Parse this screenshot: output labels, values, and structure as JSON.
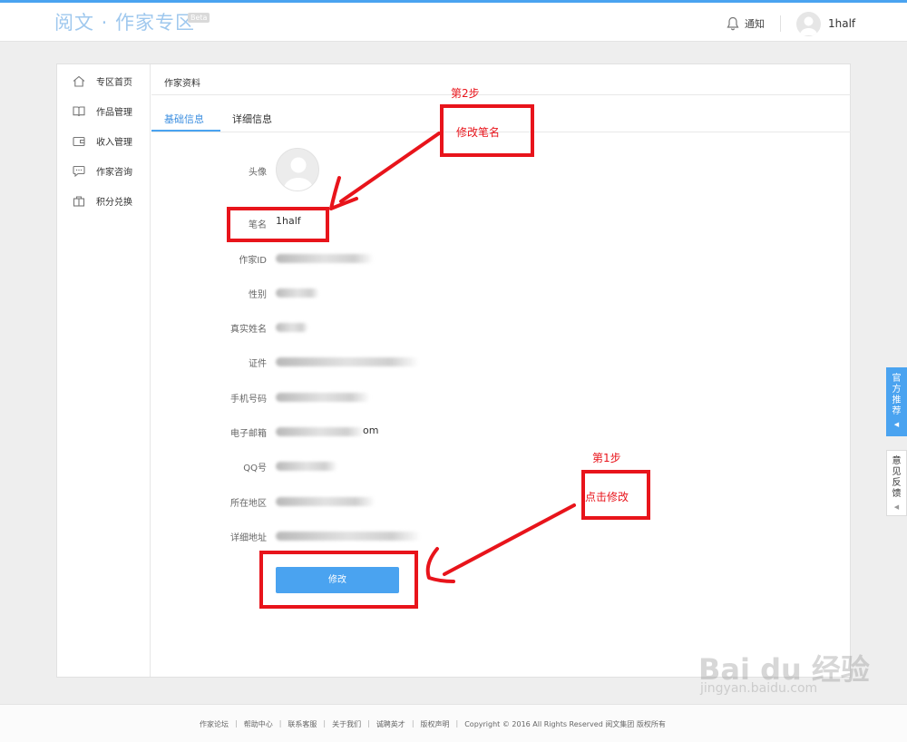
{
  "header": {
    "logo": "阅文 · 作家专区",
    "beta": "Beta",
    "notice": "通知",
    "username": "1half"
  },
  "sidebar": {
    "items": [
      {
        "label": "专区首页",
        "icon": "home-icon"
      },
      {
        "label": "作品管理",
        "icon": "book-icon"
      },
      {
        "label": "收入管理",
        "icon": "wallet-icon"
      },
      {
        "label": "作家咨询",
        "icon": "chat-icon"
      },
      {
        "label": "积分兑换",
        "icon": "gift-icon"
      }
    ]
  },
  "content": {
    "title": "作家资料",
    "tabs": [
      "基础信息",
      "详细信息"
    ],
    "labels": {
      "avatar": "头像",
      "pen_name": "笔名",
      "author_id": "作家ID",
      "gender": "性别",
      "real_name": "真实姓名",
      "id_card": "证件",
      "phone": "手机号码",
      "email": "电子邮箱",
      "qq": "QQ号",
      "region": "所在地区",
      "address": "详细地址"
    },
    "pen_name_value": "1half",
    "email_suffix": "om",
    "modify_button": "修改"
  },
  "annotations": {
    "step2": "第2步",
    "modify_pen_name": "修改笔名",
    "step1": "第1步",
    "click_modify": "点击修改"
  },
  "float": {
    "recommend": [
      "官",
      "方",
      "推",
      "荐"
    ],
    "feedback": [
      "意",
      "见",
      "反",
      "馈"
    ]
  },
  "footer": {
    "links": [
      "作家论坛",
      "帮助中心",
      "联系客服",
      "关于我们",
      "诚聘英才",
      "版权声明"
    ],
    "copyright": "Copyright © 2016 All Rights Reserved 阅文集团 版权所有"
  },
  "watermark": {
    "main": "Bai du 经验",
    "sub": "jingyan.baidu.com"
  },
  "colors": {
    "accent": "#4aa3f0",
    "annotation": "#e8141b"
  }
}
